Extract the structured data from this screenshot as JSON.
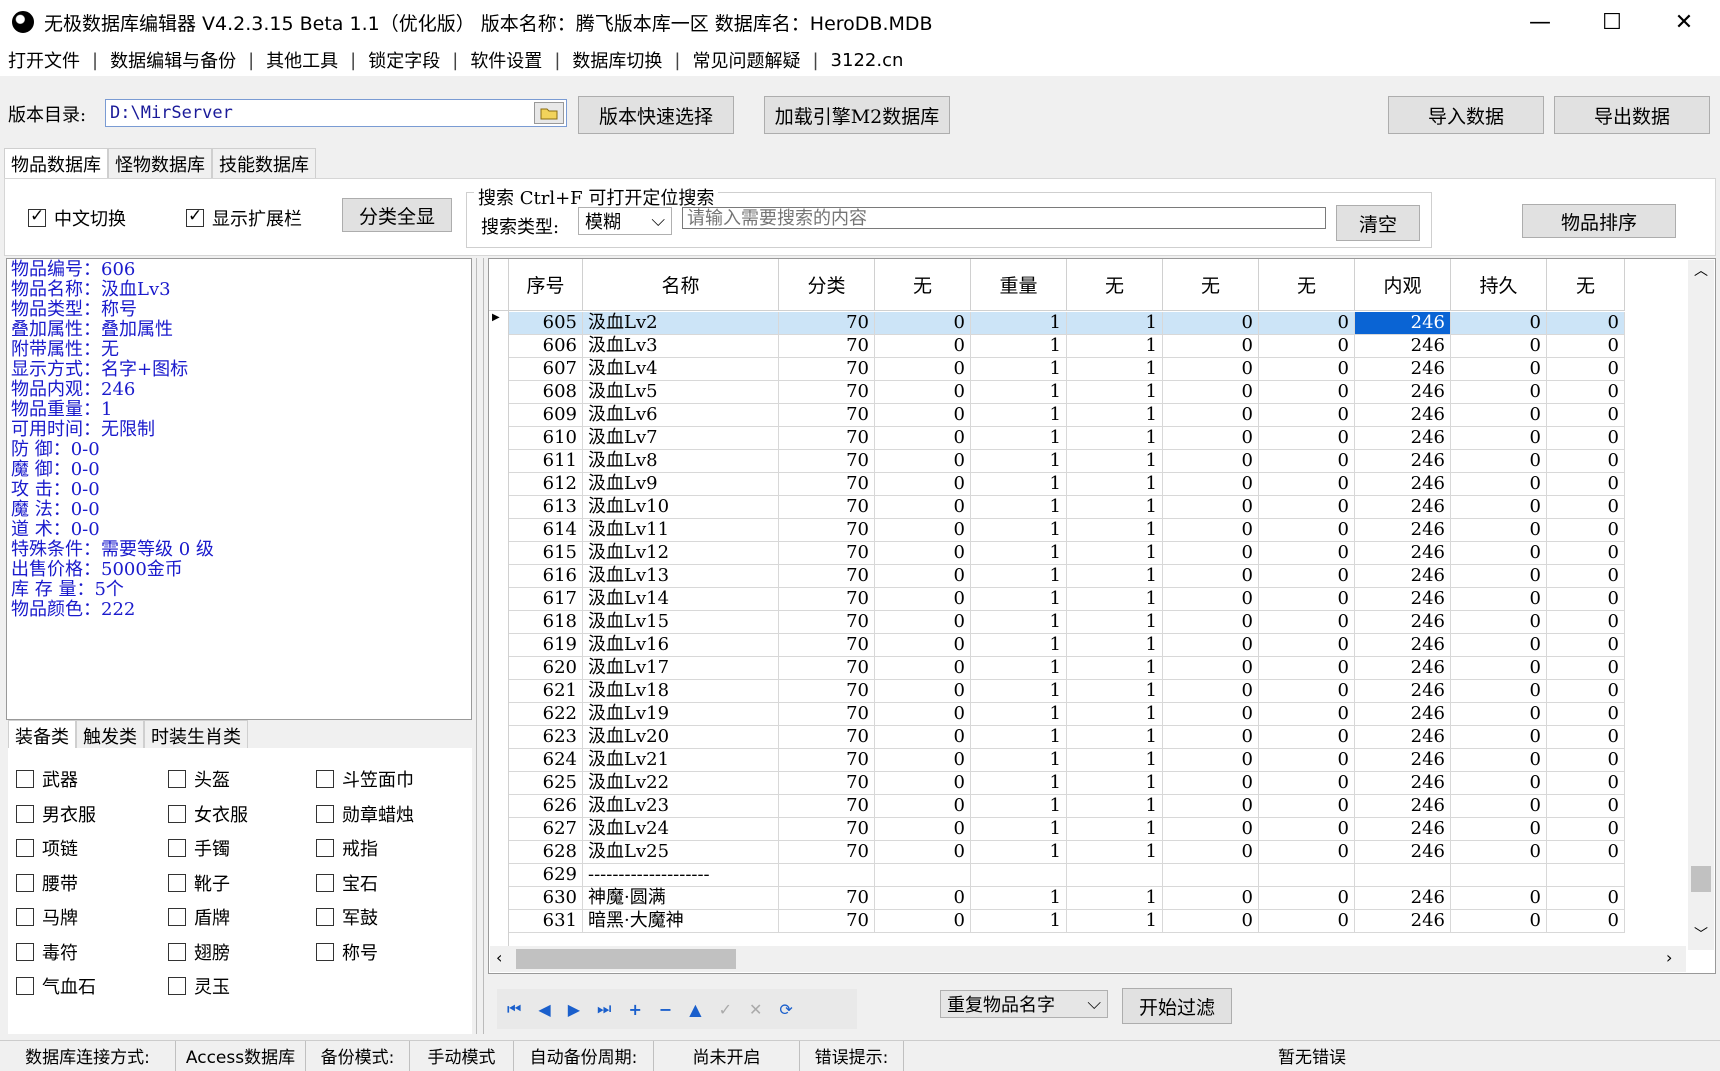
{
  "window": {
    "title": "无极数据库编辑器 V4.2.3.15    Beta 1.1（优化版）    版本名称：腾飞版本库一区    数据库名：HeroDB.MDB",
    "min": "—",
    "max": "☐",
    "close": "✕"
  },
  "menu": [
    "打开文件",
    "数据编辑与备份",
    "其他工具",
    "锁定字段",
    "软件设置",
    "数据库切换",
    "常见问题解疑",
    "3122.cn"
  ],
  "toolbar": {
    "dir_label": "版本目录:",
    "dir_value": "D:\\MirServer",
    "quick_select": "版本快速选择",
    "load_m2": "加载引擎M2数据库",
    "import": "导入数据",
    "export": "导出数据"
  },
  "tabs": [
    "物品数据库",
    "怪物数据库",
    "技能数据库"
  ],
  "options": {
    "chinese_switch": "中文切换",
    "show_ext": "显示扩展栏",
    "show_all_cat": "分类全显",
    "search_title": "搜索  Ctrl+F 可打开定位搜索",
    "search_type_label": "搜索类型:",
    "search_type_value": "模糊",
    "search_placeholder": "请输入需要搜索的内容",
    "clear": "清空",
    "sort": "物品排序"
  },
  "item_info": [
    "物品编号：606",
    "物品名称：汲血Lv3",
    "物品类型：称号",
    "叠加属性：叠加属性",
    "附带属性：无",
    "显示方式：名字+图标",
    "物品内观：246",
    "物品重量：1",
    "可用时间：无限制",
    "防    御：0-0",
    "魔    御：0-0",
    "攻    击：0-0",
    "魔    法：0-0",
    "道    术：0-0",
    "特殊条件：需要等级 0 级",
    "出售价格：5000金币",
    "库 存 量：5个",
    "物品颜色：222"
  ],
  "category_tabs": [
    "装备类",
    "触发类",
    "时装生肖类"
  ],
  "categories": [
    "武器",
    "头盔",
    "斗笠面巾",
    "男衣服",
    "女衣服",
    "勋章蜡烛",
    "项链",
    "手镯",
    "戒指",
    "腰带",
    "靴子",
    "宝石",
    "马牌",
    "盾牌",
    "军鼓",
    "毒符",
    "翅膀",
    "称号",
    "气血石",
    "灵玉"
  ],
  "grid": {
    "headers": [
      "序号",
      "名称",
      "分类",
      "无",
      "重量",
      "无",
      "无",
      "无",
      "内观",
      "持久",
      "无"
    ],
    "rows": [
      [
        "605",
        "汲血Lv2",
        "70",
        "0",
        "1",
        "1",
        "0",
        "0",
        "246",
        "0",
        "0"
      ],
      [
        "606",
        "汲血Lv3",
        "70",
        "0",
        "1",
        "1",
        "0",
        "0",
        "246",
        "0",
        "0"
      ],
      [
        "607",
        "汲血Lv4",
        "70",
        "0",
        "1",
        "1",
        "0",
        "0",
        "246",
        "0",
        "0"
      ],
      [
        "608",
        "汲血Lv5",
        "70",
        "0",
        "1",
        "1",
        "0",
        "0",
        "246",
        "0",
        "0"
      ],
      [
        "609",
        "汲血Lv6",
        "70",
        "0",
        "1",
        "1",
        "0",
        "0",
        "246",
        "0",
        "0"
      ],
      [
        "610",
        "汲血Lv7",
        "70",
        "0",
        "1",
        "1",
        "0",
        "0",
        "246",
        "0",
        "0"
      ],
      [
        "611",
        "汲血Lv8",
        "70",
        "0",
        "1",
        "1",
        "0",
        "0",
        "246",
        "0",
        "0"
      ],
      [
        "612",
        "汲血Lv9",
        "70",
        "0",
        "1",
        "1",
        "0",
        "0",
        "246",
        "0",
        "0"
      ],
      [
        "613",
        "汲血Lv10",
        "70",
        "0",
        "1",
        "1",
        "0",
        "0",
        "246",
        "0",
        "0"
      ],
      [
        "614",
        "汲血Lv11",
        "70",
        "0",
        "1",
        "1",
        "0",
        "0",
        "246",
        "0",
        "0"
      ],
      [
        "615",
        "汲血Lv12",
        "70",
        "0",
        "1",
        "1",
        "0",
        "0",
        "246",
        "0",
        "0"
      ],
      [
        "616",
        "汲血Lv13",
        "70",
        "0",
        "1",
        "1",
        "0",
        "0",
        "246",
        "0",
        "0"
      ],
      [
        "617",
        "汲血Lv14",
        "70",
        "0",
        "1",
        "1",
        "0",
        "0",
        "246",
        "0",
        "0"
      ],
      [
        "618",
        "汲血Lv15",
        "70",
        "0",
        "1",
        "1",
        "0",
        "0",
        "246",
        "0",
        "0"
      ],
      [
        "619",
        "汲血Lv16",
        "70",
        "0",
        "1",
        "1",
        "0",
        "0",
        "246",
        "0",
        "0"
      ],
      [
        "620",
        "汲血Lv17",
        "70",
        "0",
        "1",
        "1",
        "0",
        "0",
        "246",
        "0",
        "0"
      ],
      [
        "621",
        "汲血Lv18",
        "70",
        "0",
        "1",
        "1",
        "0",
        "0",
        "246",
        "0",
        "0"
      ],
      [
        "622",
        "汲血Lv19",
        "70",
        "0",
        "1",
        "1",
        "0",
        "0",
        "246",
        "0",
        "0"
      ],
      [
        "623",
        "汲血Lv20",
        "70",
        "0",
        "1",
        "1",
        "0",
        "0",
        "246",
        "0",
        "0"
      ],
      [
        "624",
        "汲血Lv21",
        "70",
        "0",
        "1",
        "1",
        "0",
        "0",
        "246",
        "0",
        "0"
      ],
      [
        "625",
        "汲血Lv22",
        "70",
        "0",
        "1",
        "1",
        "0",
        "0",
        "246",
        "0",
        "0"
      ],
      [
        "626",
        "汲血Lv23",
        "70",
        "0",
        "1",
        "1",
        "0",
        "0",
        "246",
        "0",
        "0"
      ],
      [
        "627",
        "汲血Lv24",
        "70",
        "0",
        "1",
        "1",
        "0",
        "0",
        "246",
        "0",
        "0"
      ],
      [
        "628",
        "汲血Lv25",
        "70",
        "0",
        "1",
        "1",
        "0",
        "0",
        "246",
        "0",
        "0"
      ],
      [
        "629",
        "--------------------",
        "",
        "",
        "",
        "",
        "",
        "",
        "",
        "",
        ""
      ],
      [
        "630",
        "神魔·圆满",
        "70",
        "0",
        "1",
        "1",
        "0",
        "0",
        "246",
        "0",
        "0"
      ],
      [
        "631",
        "暗黑·大魔神",
        "70",
        "0",
        "1",
        "1",
        "0",
        "0",
        "246",
        "0",
        "0"
      ]
    ]
  },
  "bottom": {
    "filter_type": "重复物品名字",
    "start_filter": "开始过滤"
  },
  "status": [
    "数据库连接方式:",
    "Access数据库",
    "备份模式:",
    "手动模式",
    "自动备份周期:",
    "尚未开启",
    "错误提示:",
    "暂无错误"
  ]
}
